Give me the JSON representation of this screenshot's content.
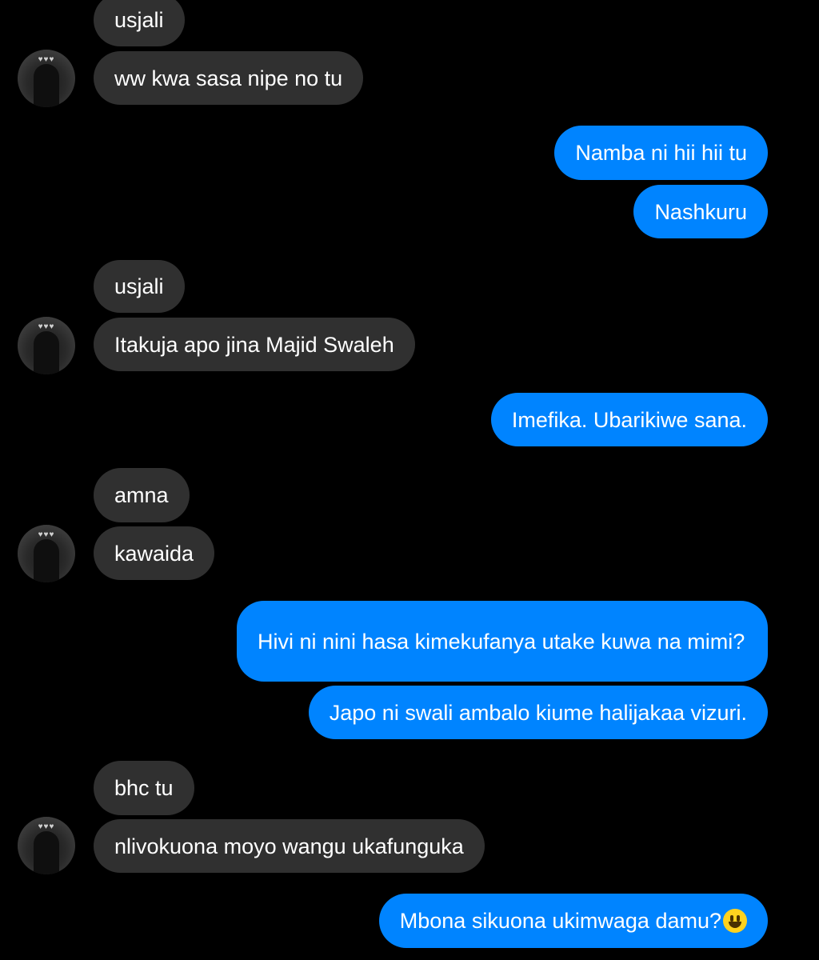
{
  "conversation": {
    "messages": [
      {
        "from": "them",
        "text": "usjali"
      },
      {
        "from": "them",
        "text": "ww kwa sasa nipe no tu"
      },
      {
        "from": "me",
        "text": "Namba ni hii hii tu"
      },
      {
        "from": "me",
        "text": "Nashkuru"
      },
      {
        "from": "them",
        "text": "usjali"
      },
      {
        "from": "them",
        "text": "Itakuja apo jina Majid Swaleh"
      },
      {
        "from": "me",
        "text": "Imefika. Ubarikiwe sana."
      },
      {
        "from": "them",
        "text": "amna"
      },
      {
        "from": "them",
        "text": "kawaida"
      },
      {
        "from": "me",
        "text": "Hivi ni nini hasa kimekufanya utake kuwa na mimi?"
      },
      {
        "from": "me",
        "text": "Japo ni swali ambalo kiume halijakaa vizuri."
      },
      {
        "from": "them",
        "text": "bhc tu"
      },
      {
        "from": "them",
        "text": "nlivokuona moyo wangu ukafunguka"
      },
      {
        "from": "me",
        "text": "Mbona sikuona ukimwaga damu?",
        "emoji": "smiley-emoji"
      }
    ]
  },
  "avatar": {
    "decoration": "♥♥♥",
    "icon": "contact-avatar"
  },
  "colors": {
    "background": "#000000",
    "received_bubble": "#303030",
    "sent_bubble": "#0084ff",
    "text": "#ffffff"
  }
}
